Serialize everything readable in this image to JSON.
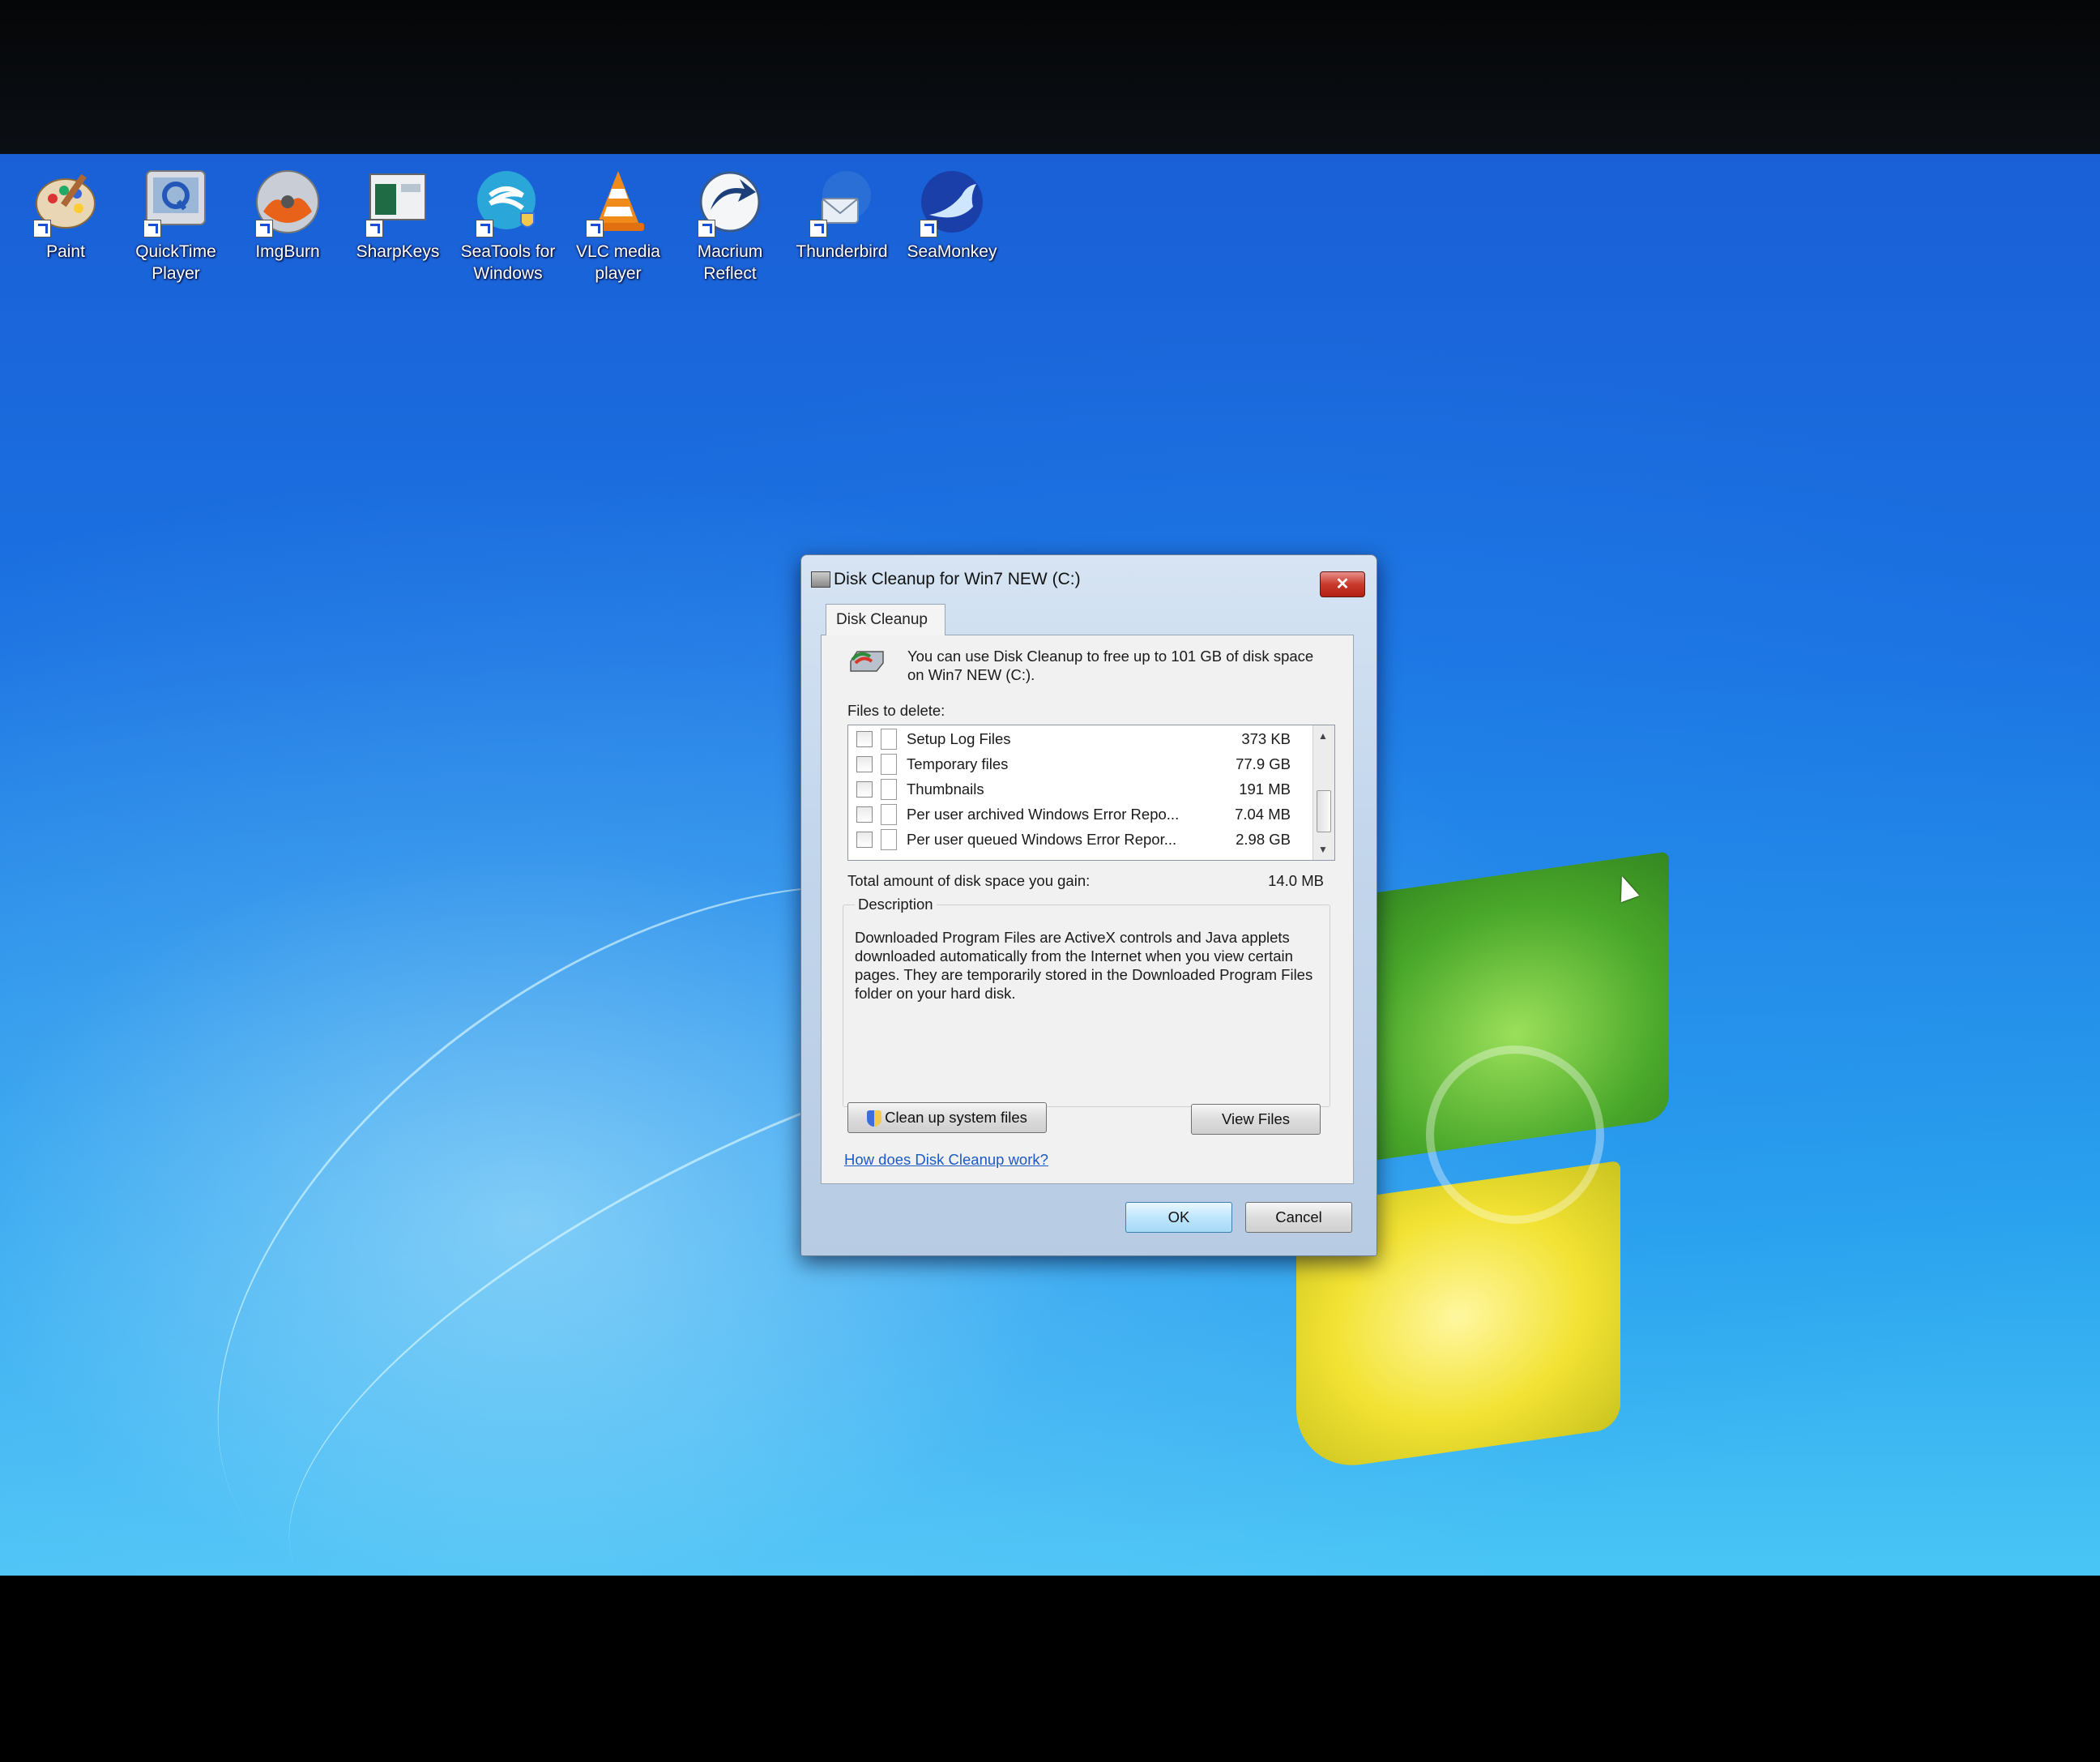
{
  "desktop": {
    "icons": [
      {
        "label": "Paint",
        "icon": "paint-icon"
      },
      {
        "label": "QuickTime Player",
        "icon": "quicktime-icon"
      },
      {
        "label": "ImgBurn",
        "icon": "imgburn-icon"
      },
      {
        "label": "SharpKeys",
        "icon": "sharpkeys-icon"
      },
      {
        "label": "SeaTools for Windows",
        "icon": "seatools-icon"
      },
      {
        "label": "VLC media player",
        "icon": "vlc-icon"
      },
      {
        "label": "Macrium Reflect",
        "icon": "macrium-icon"
      },
      {
        "label": "Thunderbird",
        "icon": "thunderbird-icon"
      },
      {
        "label": "SeaMonkey",
        "icon": "seamonkey-icon"
      }
    ]
  },
  "dialog": {
    "title": "Disk Cleanup for Win7 NEW (C:)",
    "close_label": "✕",
    "tab_label": "Disk Cleanup",
    "intro_text": "You can use Disk Cleanup to free up to 101 GB of disk space on Win7 NEW (C:).",
    "files_label": "Files to delete:",
    "files": [
      {
        "name": "Setup Log Files",
        "size": "373 KB",
        "checked": false
      },
      {
        "name": "Temporary files",
        "size": "77.9 GB",
        "checked": false
      },
      {
        "name": "Thumbnails",
        "size": "191 MB",
        "checked": false
      },
      {
        "name": "Per user archived Windows Error Repo...",
        "size": "7.04 MB",
        "checked": false
      },
      {
        "name": "Per user queued Windows Error Repor...",
        "size": "2.98 GB",
        "checked": false
      }
    ],
    "gain_label": "Total amount of disk space you gain:",
    "gain_value": "14.0 MB",
    "description_legend": "Description",
    "description_text": "Downloaded Program Files are ActiveX controls and Java applets downloaded automatically from the Internet when you view certain pages. They are temporarily stored in the Downloaded Program Files folder on your hard disk.",
    "cleanup_button": "Clean up system files",
    "view_files_button": "View Files",
    "help_link": "How does Disk Cleanup work?",
    "ok_button": "OK",
    "cancel_button": "Cancel"
  },
  "colors": {
    "desktop_blue": "#1b73e2",
    "link": "#1c5ac4",
    "close_red": "#c8392c"
  }
}
